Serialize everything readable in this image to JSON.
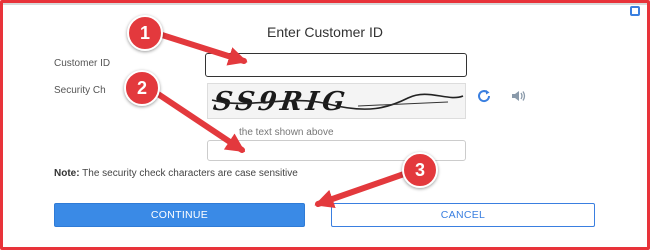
{
  "dialog": {
    "title": "Enter Customer ID",
    "customer_id_label": "Customer ID",
    "customer_id_value": "",
    "security_label": "Security Ch",
    "captcha_text": "SS9RIG",
    "hint": "the text shown above",
    "hint_value": "",
    "note_prefix": "Note:",
    "note_text": " The security check characters are case sensitive",
    "continue_label": "CONTINUE",
    "cancel_label": "CANCEL"
  },
  "icons": {
    "refresh": "refresh-icon",
    "audio": "speaker-icon"
  },
  "annotations": {
    "markers": [
      "1",
      "2",
      "3"
    ],
    "color": "#e3393d"
  },
  "colors": {
    "frame": "#e8333a",
    "primary": "#3a8ae6"
  }
}
